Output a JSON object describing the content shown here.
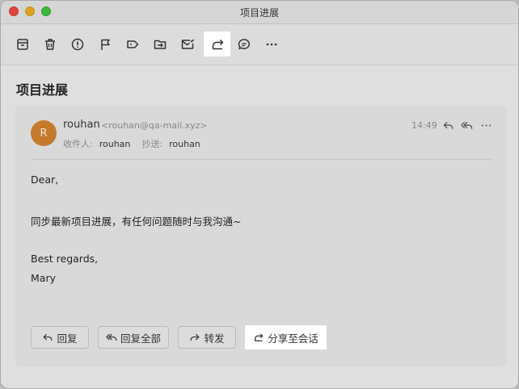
{
  "window": {
    "title": "项目进展"
  },
  "page": {
    "heading": "项目进展"
  },
  "toolbar": {
    "buttons": [
      {
        "icon": "archive-icon"
      },
      {
        "icon": "trash-icon"
      },
      {
        "icon": "spam-icon"
      },
      {
        "icon": "flag-icon"
      },
      {
        "icon": "tag-icon"
      },
      {
        "icon": "move-to-folder-icon"
      },
      {
        "icon": "mark-unread-icon"
      },
      {
        "icon": "share-icon"
      },
      {
        "icon": "chat-icon"
      },
      {
        "icon": "more-icon"
      }
    ]
  },
  "email": {
    "avatar_letter": "R",
    "sender_name": "rouhan",
    "sender_email": "<rouhan@qa-mail.xyz>",
    "to_label": "收件人:",
    "to_value": "rouhan",
    "cc_label": "抄送:",
    "cc_value": "rouhan",
    "time": "14:49",
    "body": {
      "greeting": "Dear,",
      "line1": "同步最新项目进展，有任何问题随时与我沟通~",
      "closing": "Best regards,",
      "signature": "Mary"
    }
  },
  "actions": {
    "reply": "回复",
    "reply_all": "回复全部",
    "forward": "转发",
    "share_to_chat": "分享至会话"
  }
}
